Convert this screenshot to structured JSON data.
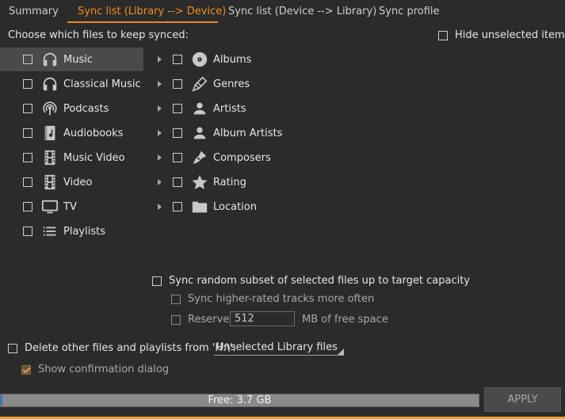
{
  "tabs": [
    {
      "label": "Summary"
    },
    {
      "label": "Sync list (Library --> Device)"
    },
    {
      "label": "Sync list (Device --> Library)"
    },
    {
      "label": "Sync profile"
    }
  ],
  "active_tab_index": 1,
  "colors": {
    "accent": "#f0901e",
    "background": "#2b2b2b",
    "selected_row": "#4a4a4a"
  },
  "header": {
    "choose_label": "Choose which files to keep synced:",
    "hide_unselected_label": "Hide unselected items"
  },
  "left_items": [
    {
      "label": "Music",
      "icon": "headphones-icon"
    },
    {
      "label": "Classical Music",
      "icon": "headphones-icon"
    },
    {
      "label": "Podcasts",
      "icon": "podcast-icon"
    },
    {
      "label": "Audiobooks",
      "icon": "audiobook-icon"
    },
    {
      "label": "Music Video",
      "icon": "film-icon"
    },
    {
      "label": "Video",
      "icon": "film-icon"
    },
    {
      "label": "TV",
      "icon": "tv-icon"
    },
    {
      "label": "Playlists",
      "icon": "list-icon"
    }
  ],
  "right_items": [
    {
      "label": "Albums",
      "icon": "disc-icon"
    },
    {
      "label": "Genres",
      "icon": "pencil-icon"
    },
    {
      "label": "Artists",
      "icon": "person-icon"
    },
    {
      "label": "Album Artists",
      "icon": "person-icon"
    },
    {
      "label": "Composers",
      "icon": "pen-nib-icon"
    },
    {
      "label": "Rating",
      "icon": "star-icon"
    },
    {
      "label": "Location",
      "icon": "folder-icon"
    }
  ],
  "random": {
    "label": "Sync random subset of selected files up to target capacity",
    "higher_rated_label": "Sync higher-rated tracks more often",
    "reserve_label": "Reserve",
    "reserve_value": "512",
    "reserve_unit": "MB of free space"
  },
  "delete": {
    "label": "Delete other files and playlists from 'H:\\':",
    "dropdown_value": "Unselected Library files",
    "confirm_label": "Show confirmation dialog"
  },
  "footer": {
    "free_text": "Free: 3.7 GB",
    "used_fraction": 0.004,
    "apply_label": "APPLY"
  }
}
